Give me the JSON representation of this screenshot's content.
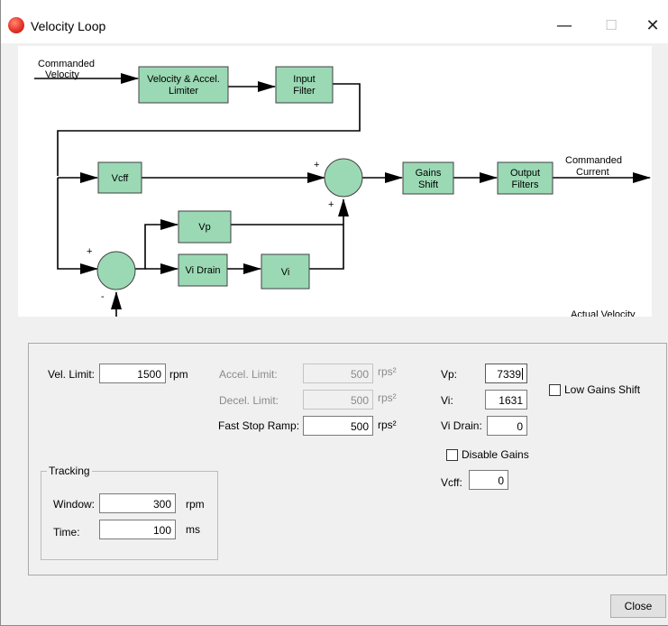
{
  "window": {
    "title": "Velocity Loop",
    "minimize_glyph": "—",
    "maximize_glyph": "☐",
    "close_glyph": "✕"
  },
  "diagram": {
    "commanded_velocity_line1": "Commanded",
    "commanded_velocity_line2": "Velocity",
    "limiter_line1": "Velocity & Accel.",
    "limiter_line2": "Limiter",
    "input_filter_line1": "Input",
    "input_filter_line2": "Filter",
    "vcff": "Vcff",
    "vp": "Vp",
    "vi_drain": "Vi Drain",
    "vi": "Vi",
    "gains_shift_line1": "Gains",
    "gains_shift_line2": "Shift",
    "output_filters_line1": "Output",
    "output_filters_line2": "Filters",
    "commanded_current_line1": "Commanded",
    "commanded_current_line2": "Current",
    "actual_velocity": "Actual Velocity",
    "plus": "+",
    "minus": "-"
  },
  "params": {
    "vel_limit_label": "Vel. Limit:",
    "vel_limit_value": "1500",
    "vel_limit_unit": "rpm",
    "accel_limit_label": "Accel. Limit:",
    "accel_limit_value": "500",
    "accel_limit_unit": "rps²",
    "decel_limit_label": "Decel. Limit:",
    "decel_limit_value": "500",
    "decel_limit_unit": "rps²",
    "fast_stop_label": "Fast Stop Ramp:",
    "fast_stop_value": "500",
    "fast_stop_unit": "rps²",
    "vp_label": "Vp:",
    "vp_value": "7339",
    "vi_label": "Vi:",
    "vi_value": "1631",
    "vi_drain_label": "Vi Drain:",
    "vi_drain_value": "0",
    "low_gains_shift_label": "Low Gains Shift",
    "disable_gains_label": "Disable Gains",
    "vcff_label": "Vcff:",
    "vcff_value": "0"
  },
  "tracking": {
    "title": "Tracking",
    "window_label": "Window:",
    "window_value": "300",
    "window_unit": "rpm",
    "time_label": "Time:",
    "time_value": "100",
    "time_unit": "ms"
  },
  "footer": {
    "close_label": "Close"
  },
  "colors": {
    "block_fill": "#9ad9b4",
    "window_bg": "#f0f0f0"
  }
}
